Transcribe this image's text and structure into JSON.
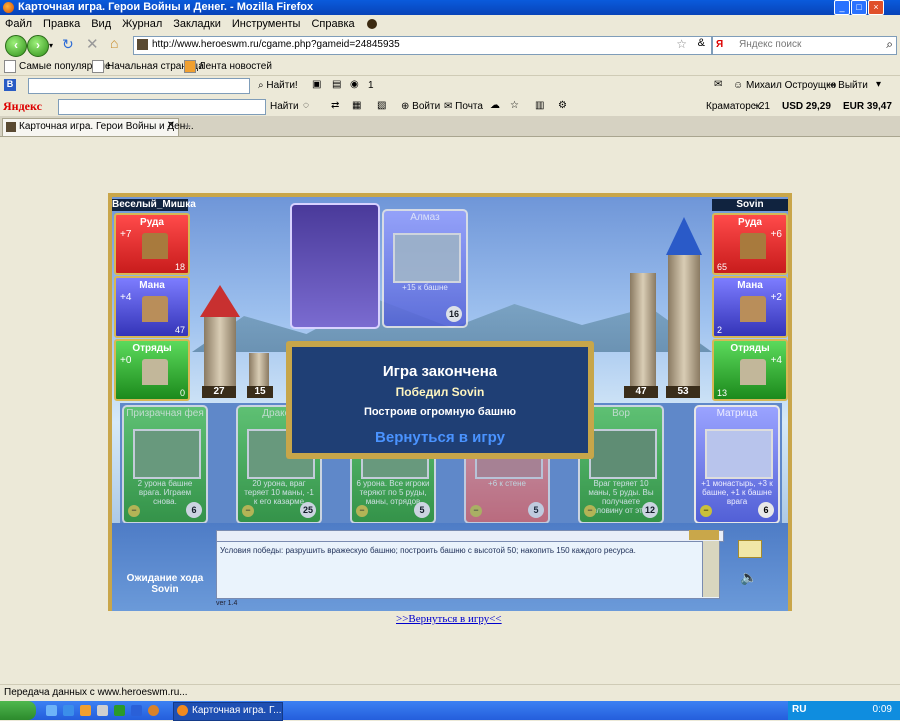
{
  "window": {
    "title": "Карточная игра. Герои Войны и Денег. - Mozilla Firefox",
    "controls": [
      "_",
      "□",
      "×"
    ]
  },
  "menu": [
    "Файл",
    "Правка",
    "Вид",
    "Журнал",
    "Закладки",
    "Инструменты",
    "Справка"
  ],
  "nav": {
    "url": "http://www.heroeswm.ru/cgame.php?gameid=24845935",
    "search_placeholder": "Яндекс поиск"
  },
  "bookmarks": [
    "Самые популярные",
    "Начальная страница",
    "Лента новостей"
  ],
  "toolbar1": {
    "find_label": "Найти!",
    "count": "1",
    "user": "Михаил Остроущко",
    "logout": "Выйти"
  },
  "toolbar2": {
    "logo": "Яндекс",
    "find_label": "Найти",
    "login": "Войти",
    "mail": "Почта",
    "city": "Краматорск",
    "temp": "−21",
    "usd": "USD 29,29",
    "eur": "EUR 39,47"
  },
  "tab": {
    "label": "Карточная игра. Герои Войны и Ден...",
    "new_tab": "+"
  },
  "game": {
    "player_left": {
      "name": "Веселый_Мишка",
      "resources": [
        {
          "label": "Руда",
          "prod": "+7",
          "qty": "18",
          "color": "red"
        },
        {
          "label": "Мана",
          "prod": "+4",
          "qty": "47",
          "color": "blue"
        },
        {
          "label": "Отряды",
          "prod": "+0",
          "qty": "0",
          "color": "green"
        }
      ],
      "tower": "27",
      "wall": "15"
    },
    "player_right": {
      "name": "Sovin",
      "resources": [
        {
          "label": "Руда",
          "prod": "+6",
          "qty": "65",
          "color": "red"
        },
        {
          "label": "Мана",
          "prod": "+2",
          "qty": "2",
          "color": "blue"
        },
        {
          "label": "Отряды",
          "prod": "+4",
          "qty": "13",
          "color": "green"
        }
      ],
      "wall": "47",
      "tower": "53"
    },
    "played_card": {
      "name": "Алмаз",
      "desc": "+15 к башне",
      "cost": "16"
    },
    "hand": [
      {
        "name": "Призрачная фея",
        "desc": "2 урона башне врага. Играем снова.",
        "cost": "6",
        "color": "green"
      },
      {
        "name": "Дракон",
        "desc": "20 урона, враг теряет 10 маны, -1 к его казарме",
        "cost": "25",
        "color": "green"
      },
      {
        "name": "",
        "desc": "6 урона. Все игроки теряют по 5 руды, маны, отрядов",
        "cost": "5",
        "color": "green"
      },
      {
        "name": "",
        "desc": "+6 к стене",
        "cost": "5",
        "color": "red"
      },
      {
        "name": "Вор",
        "desc": "Враг теряет 10 маны, 5 руды. Вы получаете половину от этого",
        "cost": "12",
        "color": "green"
      },
      {
        "name": "Матрица",
        "desc": "+1 монастырь, +3 к башне, +1 к башне врага",
        "cost": "6",
        "color": "blue"
      }
    ],
    "modal": {
      "title": "Игра закончена",
      "winner": "Победил Sovin",
      "reason": "Построив огромную башню",
      "return": "Вернуться в игру"
    },
    "log": "Условия победы: разрушить вражескую башню; построить башню с высотой 50; накопить 150 каждого ресурса.",
    "waiting": "Ожидание хода Sovin",
    "version": "ver 1.4"
  },
  "back_link": ">>Вернуться в игру<<",
  "status": "Передача данных с www.heroeswm.ru...",
  "taskbar": {
    "item": "Карточная игра. Г...",
    "lang": "RU",
    "clock": "0:09"
  }
}
